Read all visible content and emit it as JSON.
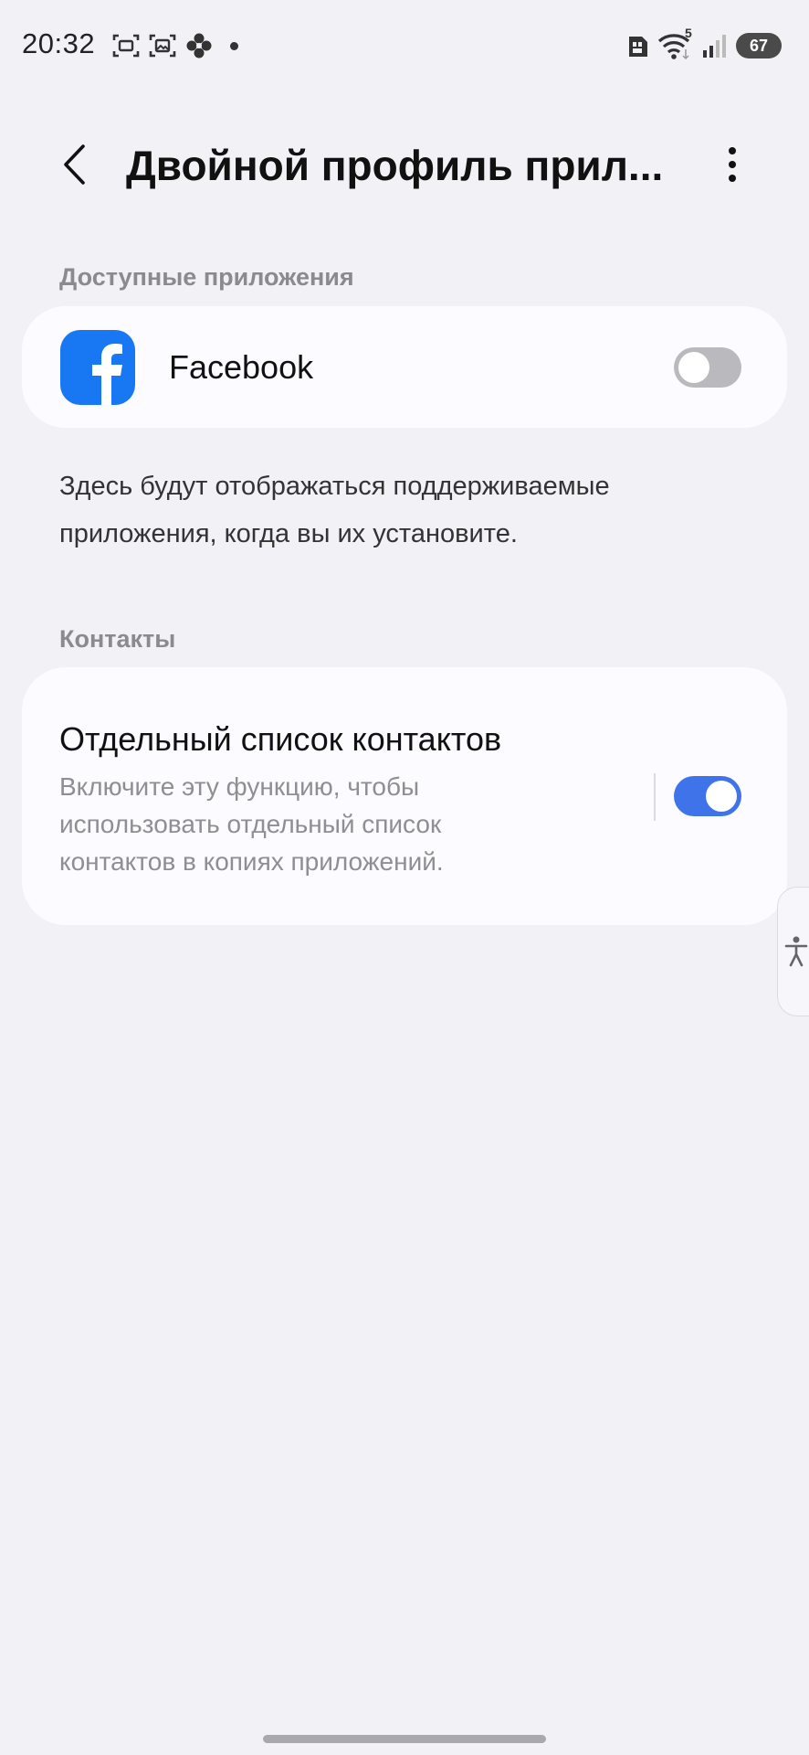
{
  "status_bar": {
    "time": "20:32",
    "left_icons": [
      "screenshot-icon",
      "gallery-icon",
      "flower-icon",
      "dot-icon"
    ],
    "right_icons": [
      "sim-icon",
      "wifi-icon",
      "signal-icon"
    ],
    "wifi_label": "5",
    "battery": "67"
  },
  "app_bar": {
    "title": "Двойной профиль прил...",
    "back_icon": "chevron-left-icon",
    "more_icon": "more-vertical-icon"
  },
  "available_apps": {
    "header": "Доступные приложения",
    "items": [
      {
        "name": "Facebook",
        "icon": "facebook-icon",
        "enabled": false
      }
    ]
  },
  "info_text": "Здесь будут отображаться поддерживаемые приложения, когда вы их установите.",
  "contacts": {
    "header": "Контакты",
    "separate_list": {
      "title": "Отдельный список контактов",
      "description": "Включите эту функцию, чтобы использовать отдельный список контактов в копиях приложений.",
      "enabled": true
    }
  },
  "colors": {
    "background": "#f2f1f6",
    "card": "#fcfbff",
    "accent": "#3e73ea",
    "toggle_off": "#b9b9be",
    "facebook": "#1877f2"
  }
}
